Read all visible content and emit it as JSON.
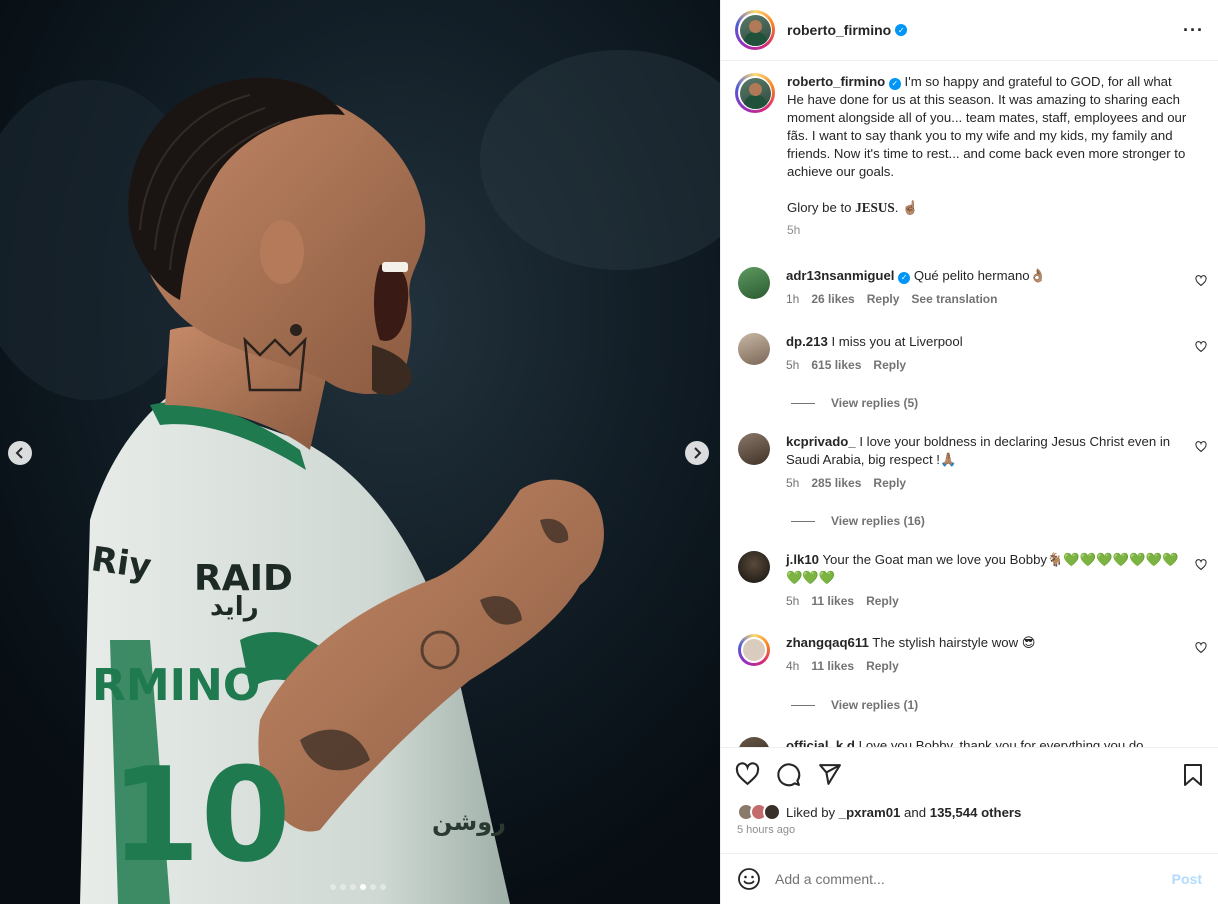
{
  "post": {
    "username": "roberto_firmino",
    "caption_text": "I'm so happy and grateful to GOD, for all what He have done for us at this season. It was amazing to sharing each moment alongside all of you... team mates, staff, employees and our fãs. I want to say thank you to my wife and my kids, my family and friends. Now it's time to rest... and come back even more stronger to achieve our goals.",
    "caption_glory_prefix": "Glory be to ",
    "caption_glory_word": "JESUS",
    "caption_glory_suffix": ". ☝🏽",
    "caption_time": "5h"
  },
  "comments": [
    {
      "username": "adr13nsanmiguel",
      "verified": true,
      "text": "Qué pelito hermano👌🏽",
      "time": "1h",
      "likes": "26 likes",
      "reply": "Reply",
      "extra": "See translation",
      "avatar_color": "#3a6b3e"
    },
    {
      "username": "dp.213",
      "verified": false,
      "text": "I miss you at Liverpool",
      "time": "5h",
      "likes": "615 likes",
      "reply": "Reply",
      "avatar_color": "#9c8a7a",
      "replies": "View replies (5)"
    },
    {
      "username": "kcprivado_",
      "verified": false,
      "text": "I love your boldness in declaring Jesus Christ even in Saudi Arabia, big respect !🙏🏽",
      "time": "5h",
      "likes": "285 likes",
      "reply": "Reply",
      "avatar_color": "#6b5a4e",
      "replies": "View replies (16)"
    },
    {
      "username": "j.lk10",
      "verified": false,
      "text": "Your the Goat man we love you Bobby🐐💚💚💚💚💚💚💚💚💚💚",
      "time": "5h",
      "likes": "11 likes",
      "reply": "Reply",
      "avatar_color": "#2a2622"
    },
    {
      "username": "zhangqaq611",
      "verified": false,
      "text": "The stylish hairstyle wow 😎",
      "time": "4h",
      "likes": "11 likes",
      "reply": "Reply",
      "avatar_color": "#c8b8a8",
      "replies": "View replies (1)"
    },
    {
      "username": "official_k.d",
      "verified": false,
      "text": "Love you Bobby, thank you for everything you do",
      "avatar_color": "#4a3a30"
    }
  ],
  "likes": {
    "prefix": "Liked by ",
    "user": "_pxram01",
    "middle": " and ",
    "count": "135,544 others"
  },
  "posted_ago": "5 hours ago",
  "add_comment": {
    "placeholder": "Add a comment...",
    "post_label": "Post"
  },
  "carousel": {
    "total": 6,
    "active_index": 3
  },
  "jersey": {
    "sponsor_text": "RAID",
    "sponsor_arabic": "رايد",
    "back_text": "Riy",
    "back_name": "RMINO",
    "number": "10",
    "chest_arabic": "روشن"
  }
}
